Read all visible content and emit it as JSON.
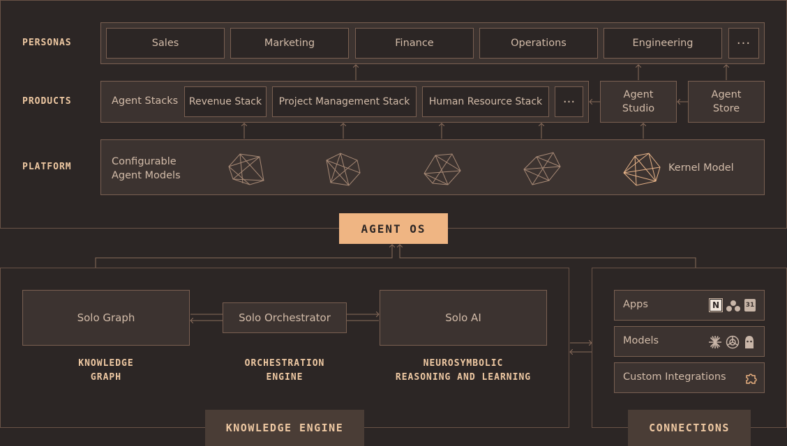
{
  "layers": {
    "personas": "PERSONAS",
    "products": "PRODUCTS",
    "platform": "PLATFORM"
  },
  "personas": [
    "Sales",
    "Marketing",
    "Finance",
    "Operations",
    "Engineering"
  ],
  "products": {
    "agent_stacks": "Agent Stacks",
    "stacks": [
      "Revenue Stack",
      "Project Management Stack",
      "Human Resource Stack"
    ],
    "agent_studio": [
      "Agent",
      "Studio"
    ],
    "agent_store": [
      "Agent",
      "Store"
    ]
  },
  "platform": {
    "configurable": [
      "Configurable",
      "Agent Models"
    ],
    "kernel": "Kernel Model"
  },
  "agent_os": "AGENT OS",
  "engine": {
    "solo_graph": "Solo Graph",
    "solo_orchestrator": "Solo Orchestrator",
    "solo_ai": "Solo AI",
    "caption_graph": [
      "KNOWLEDGE",
      "GRAPH"
    ],
    "caption_orch": [
      "ORCHESTRATION",
      "ENGINE"
    ],
    "caption_ai": [
      "NEUROSYMBOLIC",
      "REASONING AND LEARNING"
    ],
    "tab": "KNOWLEDGE ENGINE"
  },
  "connections": {
    "apps": "Apps",
    "models": "Models",
    "custom": "Custom Integrations",
    "tab": "CONNECTIONS",
    "app_icons": [
      "notion-icon",
      "asana-icon",
      "calendar-icon"
    ],
    "model_icons": [
      "claude-icon",
      "openai-icon",
      "ollama-icon"
    ]
  },
  "colors": {
    "background": "#2c2625",
    "panel": "#3c3330",
    "border": "#7a6052",
    "accent": "#efb583",
    "label": "#efc9a3"
  }
}
